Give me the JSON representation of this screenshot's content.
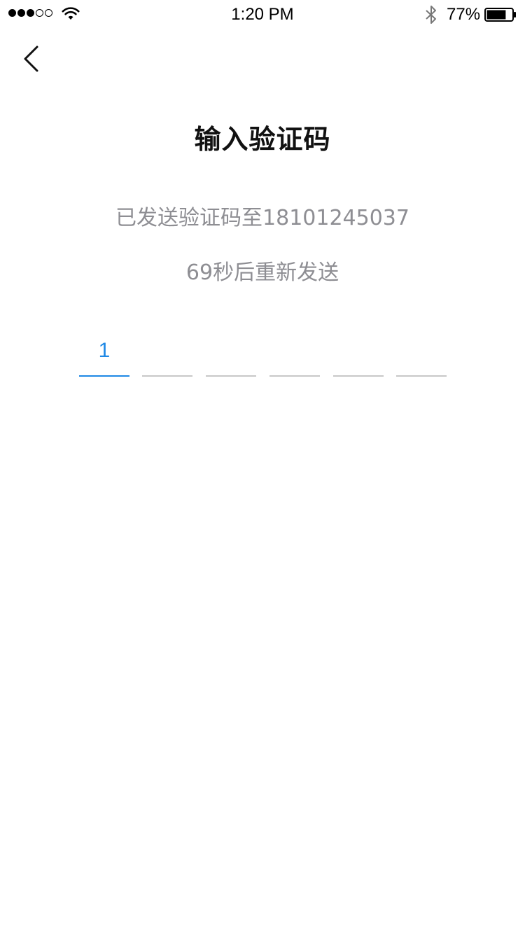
{
  "status_bar": {
    "time": "1:20 PM",
    "battery_text": "77%",
    "battery_level": 0.77
  },
  "header": {
    "title": "输入验证码"
  },
  "main": {
    "sent_info": "已发送验证码至18101245037",
    "resend": "69秒后重新发送",
    "code_boxes": [
      {
        "value": "1"
      },
      {
        "value": ""
      },
      {
        "value": ""
      },
      {
        "value": ""
      },
      {
        "value": ""
      },
      {
        "value": ""
      }
    ]
  },
  "colors": {
    "accent": "#1e88e5",
    "text_primary": "#111111",
    "text_secondary": "#8e8e93",
    "underline": "#c8c8c8"
  },
  "icons": {
    "back": "chevron-left-icon",
    "wifi": "wifi-icon",
    "bluetooth": "bluetooth-icon",
    "battery": "battery-icon"
  }
}
